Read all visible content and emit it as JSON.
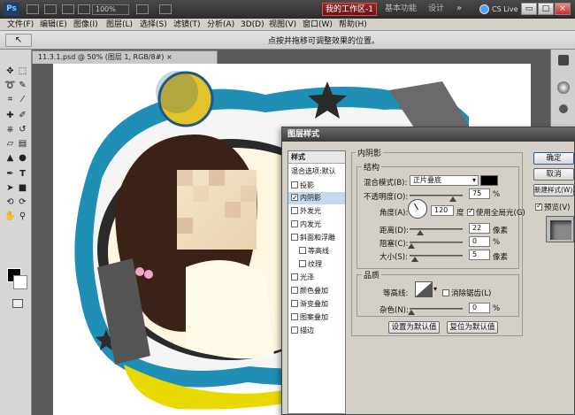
{
  "app": {
    "logo": "Ps",
    "zoom": "100%",
    "workspaces": [
      "我的工作区-1",
      "基本功能",
      "设计"
    ],
    "cs_live": "CS Live"
  },
  "window_controls": [
    "▭",
    "□",
    "×"
  ],
  "menus": [
    "文件(F)",
    "编辑(E)",
    "图像(I)",
    "图层(L)",
    "选择(S)",
    "滤镜(T)",
    "分析(A)",
    "3D(D)",
    "视图(V)",
    "窗口(W)",
    "帮助(H)"
  ],
  "options_bar": {
    "tool_glyph": "↖",
    "hint": "点按并拖移可调整效果的位置。"
  },
  "document": {
    "tab_title": "11.3.1.psd @ 50% (图层 1, RGB/8#) ×"
  },
  "toolbox": {
    "icons": [
      "move-tool-icon",
      "marquee-tool-icon",
      "lasso-tool-icon",
      "quick-select-tool-icon",
      "crop-tool-icon",
      "eyedropper-tool-icon",
      "healing-tool-icon",
      "brush-tool-icon",
      "clone-tool-icon",
      "history-brush-icon",
      "eraser-tool-icon",
      "gradient-tool-icon",
      "blur-tool-icon",
      "dodge-tool-icon",
      "pen-tool-icon",
      "type-tool-icon",
      "path-select-icon",
      "shape-tool-icon",
      "3d-rotate-icon",
      "3d-orbit-icon",
      "hand-tool-icon",
      "zoom-tool-icon"
    ],
    "colors": {
      "foreground": "#000000",
      "background": "#ffffff"
    }
  },
  "dialog": {
    "title": "图层样式",
    "style_list": {
      "header": "样式",
      "blend_options": "混合选项:默认",
      "items": [
        {
          "label": "投影",
          "checked": false
        },
        {
          "label": "内阴影",
          "checked": true
        },
        {
          "label": "外发光",
          "checked": false
        },
        {
          "label": "内发光",
          "checked": false
        },
        {
          "label": "斜面和浮雕",
          "checked": false
        },
        {
          "label": "等高线",
          "checked": false
        },
        {
          "label": "纹理",
          "checked": false
        },
        {
          "label": "光泽",
          "checked": false
        },
        {
          "label": "颜色叠加",
          "checked": false
        },
        {
          "label": "渐变叠加",
          "checked": false
        },
        {
          "label": "图案叠加",
          "checked": false
        },
        {
          "label": "描边",
          "checked": false
        }
      ]
    },
    "inner_shadow": {
      "section_title": "内阴影",
      "structure_title": "结构",
      "blend_mode_label": "混合模式(B):",
      "blend_mode_value": "正片叠底",
      "shadow_color": "#000000",
      "opacity_label": "不透明度(O):",
      "opacity_value": "75",
      "percent": "%",
      "angle_label": "角度(A):",
      "angle_value": "120",
      "degree": "度",
      "global_light_label": "使用全局光(G)",
      "global_light_checked": true,
      "distance_label": "距离(D):",
      "distance_value": "22",
      "choke_label": "阻塞(C):",
      "choke_value": "0",
      "size_label": "大小(S):",
      "size_value": "5",
      "px": "像素",
      "quality_title": "品质",
      "contour_label": "等高线:",
      "anti_alias_label": "消除锯齿(L)",
      "noise_label": "杂色(N):",
      "noise_value": "0",
      "set_default": "设置为默认值",
      "reset_default": "复位为默认值"
    },
    "buttons": {
      "ok": "确定",
      "cancel": "取消",
      "new_style": "新建样式(W)...",
      "preview": "预览(V)"
    }
  }
}
